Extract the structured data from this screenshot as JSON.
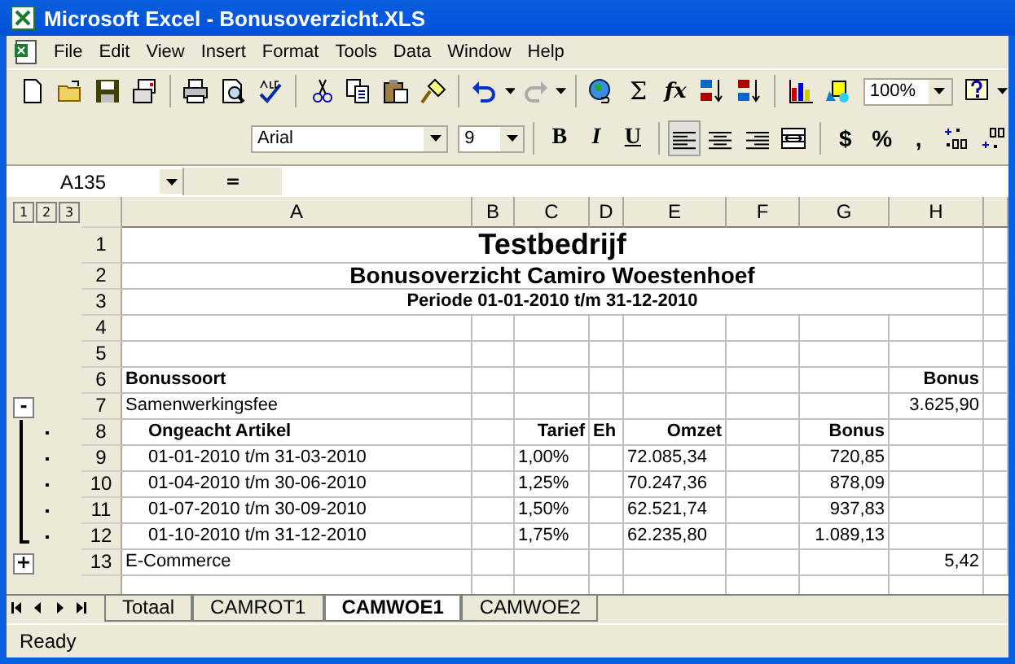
{
  "window": {
    "title": "Microsoft Excel - Bonusoverzicht.XLS"
  },
  "menu": [
    "File",
    "Edit",
    "View",
    "Insert",
    "Format",
    "Tools",
    "Data",
    "Window",
    "Help"
  ],
  "standard_toolbar": {
    "sum": "Σ",
    "function": "fx",
    "zoom": "100%"
  },
  "formatting_toolbar": {
    "font": "Arial",
    "size": "9",
    "buttons": [
      {
        "kind": "bold",
        "label": "B"
      },
      {
        "kind": "italic",
        "label": "I"
      },
      {
        "kind": "underline",
        "label": "U"
      },
      {
        "kind": "align-left",
        "selected": true
      },
      {
        "kind": "align-center",
        "selected": false
      },
      {
        "kind": "align-right",
        "selected": false
      },
      {
        "kind": "merge"
      },
      {
        "kind": "currency",
        "label": "$"
      },
      {
        "kind": "percent",
        "label": "%"
      },
      {
        "kind": "comma",
        "label": ","
      },
      {
        "kind": "increase-decimal"
      },
      {
        "kind": "decrease-decimal"
      }
    ]
  },
  "formula_bar": {
    "name_box": "A135",
    "equals": "="
  },
  "outline_levels": [
    "1",
    "2",
    "3"
  ],
  "columns": [
    "A",
    "B",
    "C",
    "D",
    "E",
    "F",
    "G",
    "H"
  ],
  "rows": [
    {
      "number": "1",
      "kind": "title",
      "a": "Testbedrijf"
    },
    {
      "number": "2",
      "kind": "subtitle",
      "a": "Bonusoverzicht Camiro Woestenhoef"
    },
    {
      "number": "3",
      "kind": "period",
      "a": "Periode 01-01-2010 t/m 31-12-2010"
    },
    {
      "number": "4",
      "kind": "blank"
    },
    {
      "number": "5",
      "kind": "blank"
    },
    {
      "number": "6",
      "kind": "heading",
      "a": "Bonussoort",
      "h": "Bonus"
    },
    {
      "number": "7",
      "kind": "group",
      "outline": {
        "kind": "button",
        "symbol": "-"
      },
      "a": "Samenwerkingsfee",
      "h": "3.625,90"
    },
    {
      "number": "8",
      "kind": "detail-heading",
      "outline": {
        "kind": "dot"
      },
      "a": "Ongeacht Artikel",
      "c": "Tarief",
      "d": "Eh",
      "e": "Omzet",
      "g": "Bonus"
    },
    {
      "number": "9",
      "kind": "detail",
      "outline": {
        "kind": "dot"
      },
      "a": "01-01-2010 t/m 31-03-2010",
      "c": "1,00%",
      "e": "72.085,34",
      "g": "720,85"
    },
    {
      "number": "10",
      "kind": "detail",
      "outline": {
        "kind": "dot"
      },
      "a": "01-04-2010 t/m 30-06-2010",
      "c": "1,25%",
      "e": "70.247,36",
      "g": "878,09"
    },
    {
      "number": "11",
      "kind": "detail",
      "outline": {
        "kind": "dot"
      },
      "a": "01-07-2010 t/m 30-09-2010",
      "c": "1,50%",
      "e": "62.521,74",
      "g": "937,83"
    },
    {
      "number": "12",
      "kind": "detail",
      "outline": {
        "kind": "dot-end"
      },
      "a": "01-10-2010 t/m 31-12-2010",
      "c": "1,75%",
      "e": "62.235,80",
      "g": "1.089,13"
    },
    {
      "number": "13",
      "kind": "group",
      "outline": {
        "kind": "button",
        "symbol": "+"
      },
      "a": "E-Commerce",
      "h": "5,42"
    }
  ],
  "sheet_tabs": [
    {
      "label": "Totaal",
      "selected": false
    },
    {
      "label": "CAMROT1",
      "selected": false
    },
    {
      "label": "CAMWOE1",
      "selected": true
    },
    {
      "label": "CAMWOE2",
      "selected": false
    }
  ],
  "status_bar": {
    "text": "Ready"
  }
}
